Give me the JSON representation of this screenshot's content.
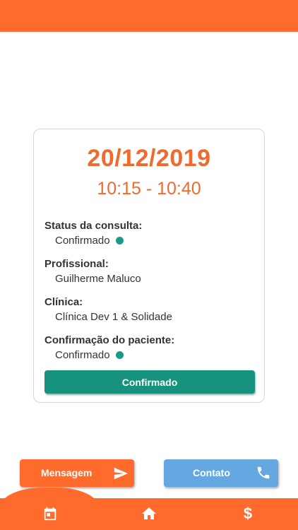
{
  "appointment": {
    "date": "20/12/2019",
    "time": "10:15 - 10:40",
    "status_label": "Status da consulta:",
    "status_value": "Confirmado",
    "professional_label": "Profissional:",
    "professional_value": "Guilherme Maluco",
    "clinic_label": "Clínica:",
    "clinic_value": "Clínica Dev 1 & Solidade",
    "patient_confirmation_label": "Confirmação do paciente:",
    "patient_confirmation_value": "Confirmado",
    "confirm_button_label": "Confirmado"
  },
  "actions": {
    "message_label": "Mensagem",
    "message_icon": "send-icon",
    "contact_label": "Contato",
    "contact_icon": "phone-icon"
  },
  "nav": {
    "items": [
      {
        "icon": "calendar-icon"
      },
      {
        "icon": "home-icon"
      },
      {
        "icon": "dollar-icon",
        "glyph": "$"
      }
    ]
  },
  "colors": {
    "primary": "#ff6b2c",
    "accent_text": "#f06a2e",
    "teal": "#16927f",
    "contact": "#65a7e1"
  }
}
